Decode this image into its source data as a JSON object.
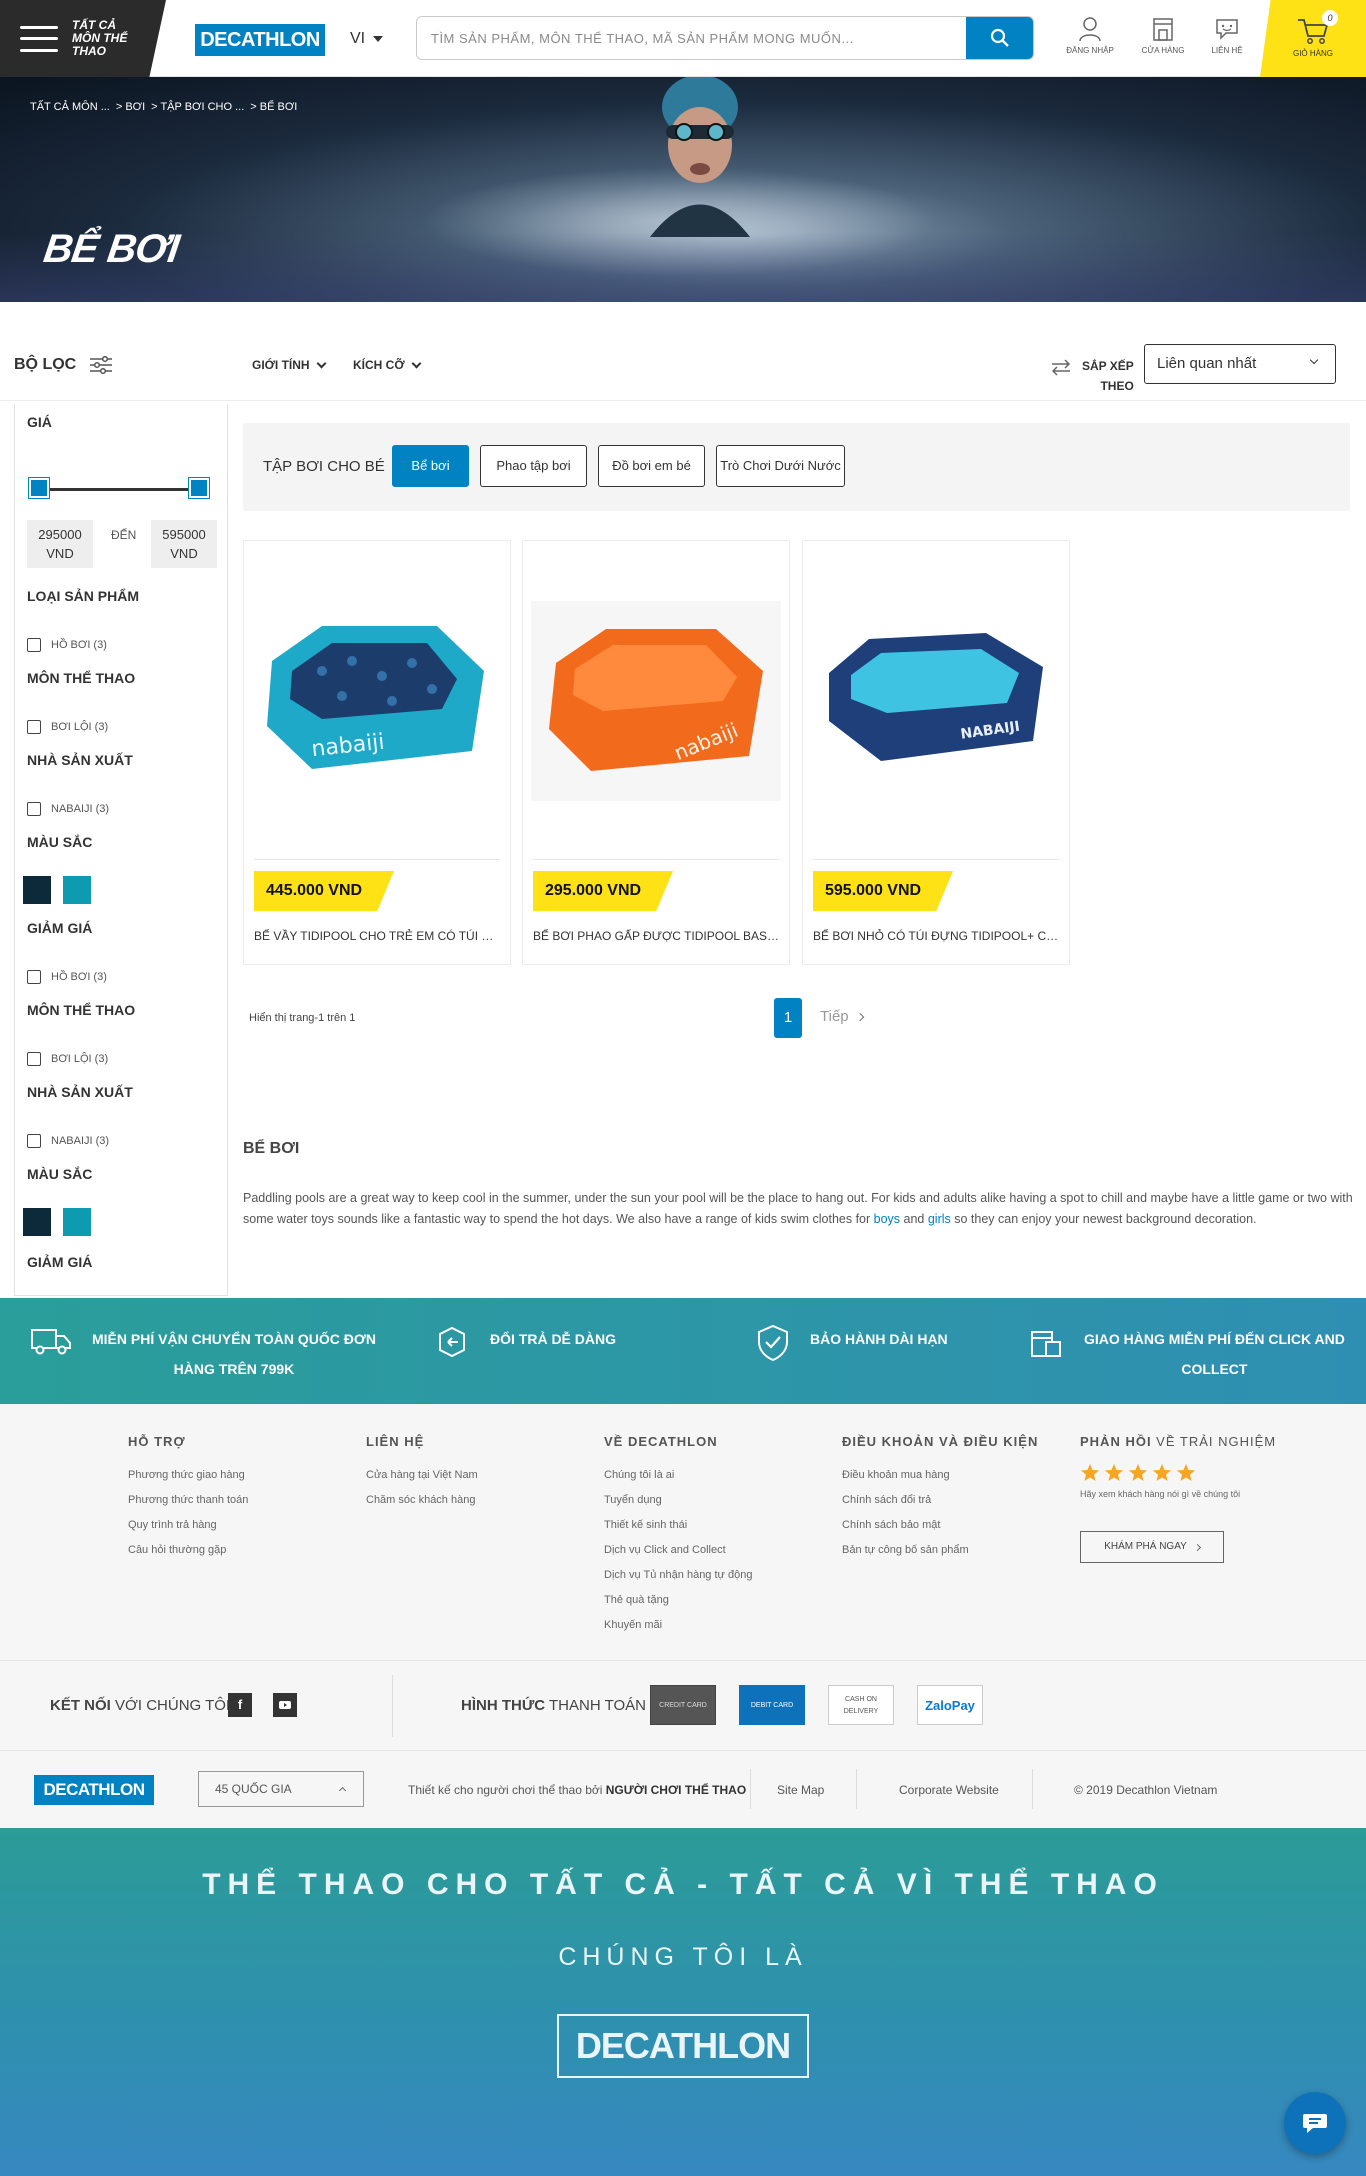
{
  "header": {
    "all_sports": "Tất cả môn thể thao",
    "logo": "DECATHLON",
    "language": "VI",
    "search_placeholder": "TÌM SẢN PHẨM, MÔN THỂ THAO, MÃ SẢN PHẨM MONG MUỐN...",
    "icons": [
      {
        "name": "user-icon",
        "label": "ĐĂNG NHẬP"
      },
      {
        "name": "store-icon",
        "label": "CỬA HÀNG"
      },
      {
        "name": "contact-icon",
        "label": "LIÊN HỆ"
      }
    ],
    "cart": {
      "label": "GIỎ HÀNG",
      "count": "0"
    }
  },
  "hero": {
    "breadcrumb": [
      "TẤT CẢ MÔN ...",
      "> BƠI",
      "> TẬP BƠI CHO ...",
      "> BỂ BƠI"
    ],
    "title": "BỂ BƠI"
  },
  "toolbar": {
    "filter_label": "BỘ LỌC",
    "gender": "GIỚI TÍNH",
    "size": "KÍCH CỠ",
    "sort_label_1": "SẮP XẾP",
    "sort_label_2": "THEO",
    "sort_value": "Liên quan nhất"
  },
  "sidebar": {
    "price_title": "GIÁ",
    "price_min": "295000",
    "price_max": "595000",
    "currency": "VND",
    "to": "ĐẾN",
    "product_type": "LOẠI SẢN PHẨM",
    "opt_pool": "HỒ BƠI (3)",
    "sport": "MÔN THỂ THAO",
    "opt_swim": "BƠI LỘI (3)",
    "brand": "NHÀ SẢN XUẤT",
    "opt_brand": "NABAIJI (3)",
    "color": "MÀU SẮC",
    "discount": "GIẢM GIÁ",
    "swatch_colors": [
      "#0d2a3a",
      "#0e9bb0"
    ]
  },
  "categories": {
    "label": "TẬP BƠI CHO BÉ",
    "pills": [
      "Bể bơi",
      "Phao tập bơi",
      "Đồ bơi em bé",
      "Trò Chơi Dưới Nước"
    ]
  },
  "products": [
    {
      "price": "445.000 VND",
      "name": "BỂ VẦY TIDIPOOL CHO TRẺ EM CÓ TÚI ĐỰNG"
    },
    {
      "price": "295.000 VND",
      "name": "BỂ BƠI PHAO GẤP ĐƯỢC TIDIPOOL BASIC CHO"
    },
    {
      "price": "595.000 VND",
      "name": "BỂ BƠI NHỎ CÓ TÚI ĐỰNG TIDIPOOL+ CHO TRẺ"
    }
  ],
  "pagination": {
    "info": "Hiển thị trang-1 trên 1",
    "current": "1",
    "next": "Tiếp"
  },
  "seo": {
    "title": "BỂ BƠI",
    "text_1": "Paddling pools are a great way to keep cool in the summer, under the sun your pool will be the place to hang out.  For kids and adults alike having a spot to chill and maybe have a little game or two with some water toys sounds like a fantastic way to spend the hot days. We also have a range of kids swim clothes for ",
    "link_boys": "boys",
    "text_and": " and ",
    "link_girls": "girls",
    "text_2": " so they can enjoy your newest background decoration."
  },
  "services": [
    {
      "line1": "MIỄN PHÍ VẬN CHUYỂN TOÀN QUỐC ĐƠN",
      "line2": "HÀNG TRÊN 799K"
    },
    {
      "line1": "ĐỔI TRẢ DỄ DÀNG",
      "line2": ""
    },
    {
      "line1": "BẢO HÀNH DÀI HẠN",
      "line2": ""
    },
    {
      "line1": "GIAO HÀNG MIỄN PHÍ ĐẾN CLICK AND",
      "line2": "COLLECT"
    }
  ],
  "footer": {
    "support": {
      "title": "HỖ TRỢ",
      "links": [
        "Phương thức giao hàng",
        "Phương thức thanh toán",
        "Quy trình trả hàng",
        "Câu hỏi thường gặp"
      ]
    },
    "contact": {
      "title": "LIÊN HỆ",
      "links": [
        "Cửa hàng tại Việt Nam",
        "Chăm sóc khách hàng"
      ]
    },
    "about": {
      "title": "VỀ DECATHLON",
      "links": [
        "Chúng tôi là ai",
        "Tuyển dụng",
        "Thiết kế sinh thái",
        "Dịch vụ Click and Collect",
        "Dịch vụ Tủ nhận hàng tự động",
        "Thẻ quà tặng",
        "Khuyến mãi"
      ]
    },
    "terms": {
      "title": "ĐIỀU KHOẢN VÀ ĐIỀU KIỆN",
      "links": [
        "Điều khoản mua hàng",
        "Chính sách đổi trả",
        "Chính sách bảo mật",
        "Bản tự công bố sản phẩm"
      ]
    },
    "feedback": {
      "title_bold": "PHẢN HỒI",
      "title_rest": " VỀ TRẢI NGHIỆM",
      "note": "Hãy xem khách hàng nói gì về chúng tôi",
      "button": "KHÁM PHÁ NGAY",
      "rating": 5
    }
  },
  "connect": {
    "label_bold": "KẾT NỐI",
    "label_rest": " VỚI CHÚNG TÔI",
    "pay_bold": "HÌNH THỨC",
    "pay_rest": " THANH TOÁN",
    "payments": [
      "CREDIT CARD",
      "DEBIT CARD",
      "CASH ON DELIVERY",
      "ZaloPay"
    ]
  },
  "bottom": {
    "logo": "DECATHLON",
    "country": "45 QUỐC GIA",
    "designed_prefix": "Thiết kế cho người chơi thể thao bởi ",
    "designed_by": "NGƯỜI CHƠI THỂ THAO",
    "sitemap": "Site Map",
    "corporate": "Corporate Website",
    "copyright": "© 2019 Decathlon Vietnam"
  },
  "slogan": {
    "line1": "THỂ THAO CHO TẤT CẢ - TẤT CẢ VÌ THỂ THAO",
    "line2": "CHÚNG TÔI LÀ",
    "logo": "DECATHLON"
  },
  "colors": {
    "brand_blue": "#0082c3",
    "price_yellow": "#fee215",
    "teal": "#2a9e9a"
  }
}
